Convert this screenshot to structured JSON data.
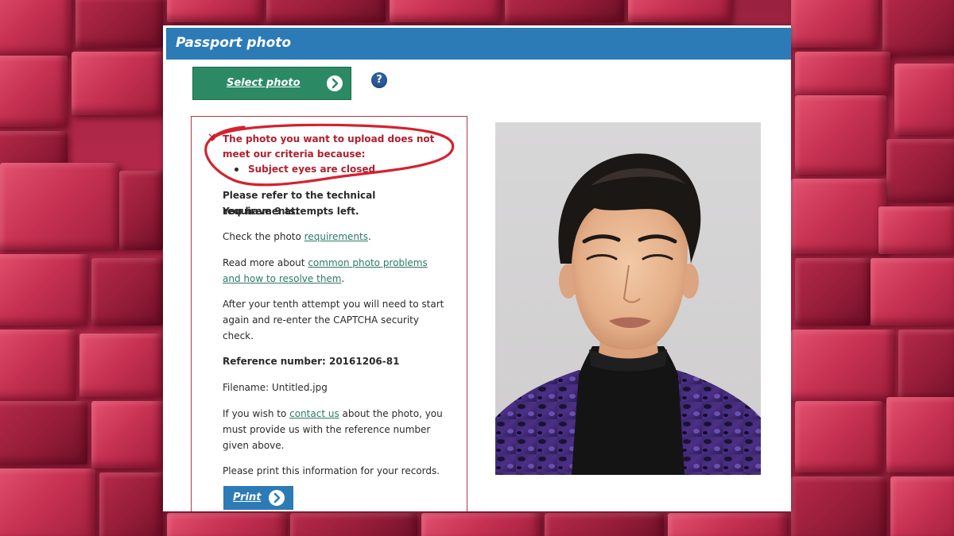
{
  "window": {
    "title": "Passport photo",
    "select_label": "Select photo",
    "help_symbol": "?"
  },
  "error": {
    "mark": "✕",
    "message": "The photo you want to upload does not meet our criteria because:",
    "reason": "Subject eyes are closed"
  },
  "info": {
    "refer": "Please refer to the technical requirements.",
    "attempts": "You have 9 attempts left.",
    "check_prefix": "Check the photo ",
    "check_link": "requirements",
    "check_suffix": ".",
    "read_prefix": "Read more about ",
    "read_link": "common photo problems and how to resolve them",
    "read_suffix": ".",
    "tenth": "After your tenth attempt you will need to start again and re-enter the CAPTCHA security check.",
    "reference": "Reference number: 20161206-81",
    "filename": "Filename: Untitled.jpg",
    "contact_prefix": "If you wish to ",
    "contact_link": "contact us",
    "contact_suffix": " about the photo, you must provide us with the reference number given above.",
    "print_note": "Please print this information for your records.",
    "print_label": "Print"
  },
  "icons": {
    "select": "arrow-circle-icon",
    "help": "help-icon",
    "error": "close-icon",
    "print": "arrow-circle-icon"
  },
  "colors": {
    "header": "#2c7bb6",
    "select_button": "#2b8a64",
    "error_text": "#b02031",
    "link": "#2b7a66",
    "background": "#b3284a"
  }
}
